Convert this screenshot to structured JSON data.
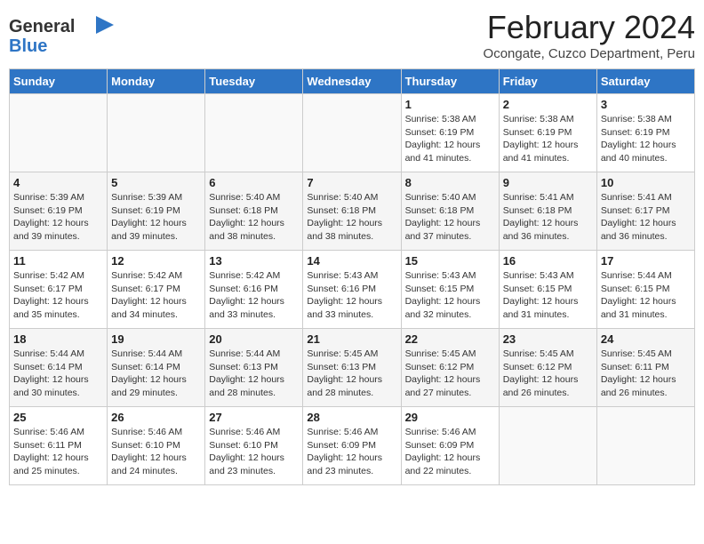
{
  "header": {
    "logo": {
      "line1": "General",
      "line2": "Blue"
    },
    "title": "February 2024",
    "subtitle": "Ocongate, Cuzco Department, Peru"
  },
  "weekdays": [
    "Sunday",
    "Monday",
    "Tuesday",
    "Wednesday",
    "Thursday",
    "Friday",
    "Saturday"
  ],
  "weeks": [
    [
      {
        "day": "",
        "info": ""
      },
      {
        "day": "",
        "info": ""
      },
      {
        "day": "",
        "info": ""
      },
      {
        "day": "",
        "info": ""
      },
      {
        "day": "1",
        "info": "Sunrise: 5:38 AM\nSunset: 6:19 PM\nDaylight: 12 hours and 41 minutes."
      },
      {
        "day": "2",
        "info": "Sunrise: 5:38 AM\nSunset: 6:19 PM\nDaylight: 12 hours and 41 minutes."
      },
      {
        "day": "3",
        "info": "Sunrise: 5:38 AM\nSunset: 6:19 PM\nDaylight: 12 hours and 40 minutes."
      }
    ],
    [
      {
        "day": "4",
        "info": "Sunrise: 5:39 AM\nSunset: 6:19 PM\nDaylight: 12 hours and 39 minutes."
      },
      {
        "day": "5",
        "info": "Sunrise: 5:39 AM\nSunset: 6:19 PM\nDaylight: 12 hours and 39 minutes."
      },
      {
        "day": "6",
        "info": "Sunrise: 5:40 AM\nSunset: 6:18 PM\nDaylight: 12 hours and 38 minutes."
      },
      {
        "day": "7",
        "info": "Sunrise: 5:40 AM\nSunset: 6:18 PM\nDaylight: 12 hours and 38 minutes."
      },
      {
        "day": "8",
        "info": "Sunrise: 5:40 AM\nSunset: 6:18 PM\nDaylight: 12 hours and 37 minutes."
      },
      {
        "day": "9",
        "info": "Sunrise: 5:41 AM\nSunset: 6:18 PM\nDaylight: 12 hours and 36 minutes."
      },
      {
        "day": "10",
        "info": "Sunrise: 5:41 AM\nSunset: 6:17 PM\nDaylight: 12 hours and 36 minutes."
      }
    ],
    [
      {
        "day": "11",
        "info": "Sunrise: 5:42 AM\nSunset: 6:17 PM\nDaylight: 12 hours and 35 minutes."
      },
      {
        "day": "12",
        "info": "Sunrise: 5:42 AM\nSunset: 6:17 PM\nDaylight: 12 hours and 34 minutes."
      },
      {
        "day": "13",
        "info": "Sunrise: 5:42 AM\nSunset: 6:16 PM\nDaylight: 12 hours and 33 minutes."
      },
      {
        "day": "14",
        "info": "Sunrise: 5:43 AM\nSunset: 6:16 PM\nDaylight: 12 hours and 33 minutes."
      },
      {
        "day": "15",
        "info": "Sunrise: 5:43 AM\nSunset: 6:15 PM\nDaylight: 12 hours and 32 minutes."
      },
      {
        "day": "16",
        "info": "Sunrise: 5:43 AM\nSunset: 6:15 PM\nDaylight: 12 hours and 31 minutes."
      },
      {
        "day": "17",
        "info": "Sunrise: 5:44 AM\nSunset: 6:15 PM\nDaylight: 12 hours and 31 minutes."
      }
    ],
    [
      {
        "day": "18",
        "info": "Sunrise: 5:44 AM\nSunset: 6:14 PM\nDaylight: 12 hours and 30 minutes."
      },
      {
        "day": "19",
        "info": "Sunrise: 5:44 AM\nSunset: 6:14 PM\nDaylight: 12 hours and 29 minutes."
      },
      {
        "day": "20",
        "info": "Sunrise: 5:44 AM\nSunset: 6:13 PM\nDaylight: 12 hours and 28 minutes."
      },
      {
        "day": "21",
        "info": "Sunrise: 5:45 AM\nSunset: 6:13 PM\nDaylight: 12 hours and 28 minutes."
      },
      {
        "day": "22",
        "info": "Sunrise: 5:45 AM\nSunset: 6:12 PM\nDaylight: 12 hours and 27 minutes."
      },
      {
        "day": "23",
        "info": "Sunrise: 5:45 AM\nSunset: 6:12 PM\nDaylight: 12 hours and 26 minutes."
      },
      {
        "day": "24",
        "info": "Sunrise: 5:45 AM\nSunset: 6:11 PM\nDaylight: 12 hours and 26 minutes."
      }
    ],
    [
      {
        "day": "25",
        "info": "Sunrise: 5:46 AM\nSunset: 6:11 PM\nDaylight: 12 hours and 25 minutes."
      },
      {
        "day": "26",
        "info": "Sunrise: 5:46 AM\nSunset: 6:10 PM\nDaylight: 12 hours and 24 minutes."
      },
      {
        "day": "27",
        "info": "Sunrise: 5:46 AM\nSunset: 6:10 PM\nDaylight: 12 hours and 23 minutes."
      },
      {
        "day": "28",
        "info": "Sunrise: 5:46 AM\nSunset: 6:09 PM\nDaylight: 12 hours and 23 minutes."
      },
      {
        "day": "29",
        "info": "Sunrise: 5:46 AM\nSunset: 6:09 PM\nDaylight: 12 hours and 22 minutes."
      },
      {
        "day": "",
        "info": ""
      },
      {
        "day": "",
        "info": ""
      }
    ]
  ]
}
